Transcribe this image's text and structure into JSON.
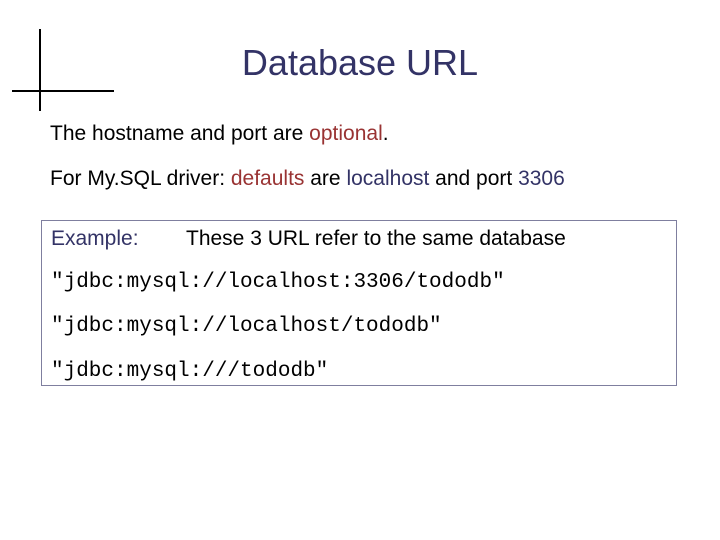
{
  "slide": {
    "title": "Database URL",
    "line1": {
      "before": "The hostname and port are ",
      "highlight": "optional",
      "after": "."
    },
    "line2": {
      "prefix": "For My.SQL driver: ",
      "defaults": "defaults",
      "are": " are ",
      "localhost": "localhost",
      "and_port": " and port ",
      "port": "3306"
    },
    "example": {
      "label": "Example:",
      "description": "These 3 URL refer to the same database",
      "urls": [
        "\"jdbc:mysql://localhost:3306/tododb\"",
        "\"jdbc:mysql://localhost/tododb\"",
        "\"jdbc:mysql:///tododb\""
      ]
    }
  },
  "colors": {
    "title": "#333366",
    "emphasis_red": "#993333",
    "emphasis_blue": "#333366",
    "box_border": "#7f7f9f"
  }
}
